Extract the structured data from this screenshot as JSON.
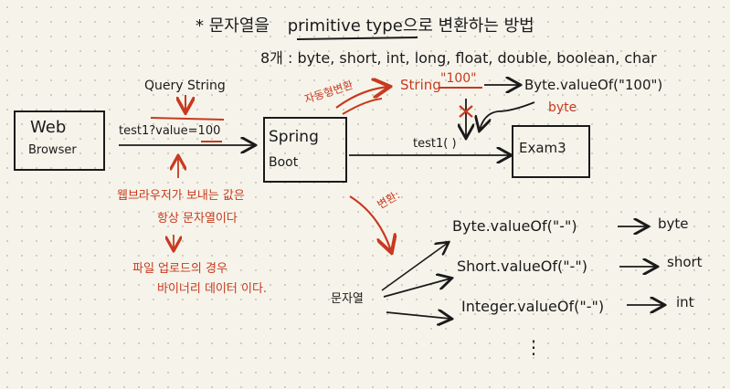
{
  "title": {
    "star": "*",
    "prefix": "문자열을",
    "highlight": "primitive type",
    "suffix": "으로 변환하는 방법"
  },
  "types_line": "8개 : byte, short, int, long, float, double, boolean, char",
  "query_string_label": "Query String",
  "url": {
    "path": "test1?value=",
    "value": "100"
  },
  "web_browser": {
    "line1": "Web",
    "line2": "Browser"
  },
  "spring_boot": {
    "line1": "Spring",
    "line2": "Boot"
  },
  "note_browser": {
    "line1": "웹브라우저가 보내는 값은",
    "line2": "항상 문자열이다"
  },
  "note_upload": {
    "line1": "파일 업로드의 경우",
    "line2": "바이너리 데이터 이다."
  },
  "auto_cast_label": "자동형변환",
  "string_conv": {
    "type": "String",
    "value": "\"100\"",
    "method": "Byte.valueOf(\"100\")",
    "byte_label": "byte"
  },
  "method_call": "test1(  )",
  "exam_box": "Exam3",
  "convert_label": "변환:",
  "source_label": "문자열",
  "conversions": [
    {
      "method": "Byte.valueOf(\"-\")",
      "result": "byte"
    },
    {
      "method": "Short.valueOf(\"-\")",
      "result": "short"
    },
    {
      "method": "Integer.valueOf(\"-\")",
      "result": "int"
    }
  ],
  "ellipsis": "⋮",
  "colors": {
    "ink": "#1a1a1a",
    "red": "#c8391f",
    "paper": "#f6f4ea"
  }
}
